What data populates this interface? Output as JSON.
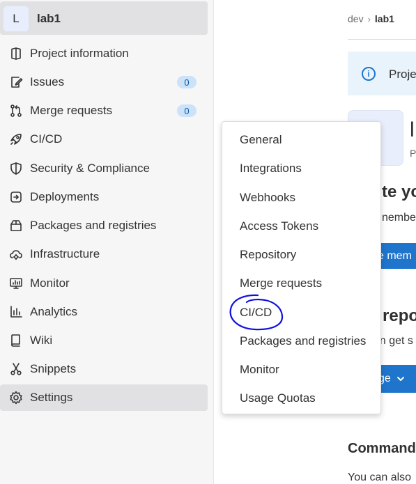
{
  "project": {
    "avatar_letter": "L",
    "name": "lab1"
  },
  "sidebar": {
    "items": [
      {
        "label": "Project information",
        "icon": "project-information-icon"
      },
      {
        "label": "Issues",
        "icon": "issues-icon",
        "count": "0"
      },
      {
        "label": "Merge requests",
        "icon": "merge-request-icon",
        "count": "0"
      },
      {
        "label": "CI/CD",
        "icon": "rocket-icon"
      },
      {
        "label": "Security & Compliance",
        "icon": "shield-icon"
      },
      {
        "label": "Deployments",
        "icon": "deployments-icon"
      },
      {
        "label": "Packages and registries",
        "icon": "package-icon"
      },
      {
        "label": "Infrastructure",
        "icon": "cloud-gear-icon"
      },
      {
        "label": "Monitor",
        "icon": "monitor-icon"
      },
      {
        "label": "Analytics",
        "icon": "chart-icon"
      },
      {
        "label": "Wiki",
        "icon": "book-icon"
      },
      {
        "label": "Snippets",
        "icon": "scissors-icon"
      },
      {
        "label": "Settings",
        "icon": "settings-icon",
        "active": true
      }
    ]
  },
  "breadcrumb": {
    "parent": "dev",
    "separator": "›",
    "current": "lab1"
  },
  "main": {
    "banner_text": "Proje",
    "big_title_fragment": "l",
    "small_fragment": "P",
    "heading_fragment_1": "te yo",
    "text_fragment_1": "nember",
    "button_fragment_1": "e mem",
    "heading_fragment_2": "repo",
    "text_fragment_2": "an get s",
    "button_fragment_2": "ge",
    "heading_fragment_3": "Command",
    "text_fragment_3": "You can also"
  },
  "settings_flyout": {
    "items": [
      "General",
      "Integrations",
      "Webhooks",
      "Access Tokens",
      "Repository",
      "Merge requests",
      "CI/CD",
      "Packages and registries",
      "Monitor",
      "Usage Quotas"
    ]
  },
  "colors": {
    "sidebar_bg": "#f6f6f7",
    "active_bg": "#e1e1e3",
    "badge_bg": "#cbe2f9",
    "badge_text": "#0b5cad",
    "primary_blue": "#1f75cb",
    "banner_bg": "#e9f3fc",
    "annotation_ink": "#1010e0"
  }
}
